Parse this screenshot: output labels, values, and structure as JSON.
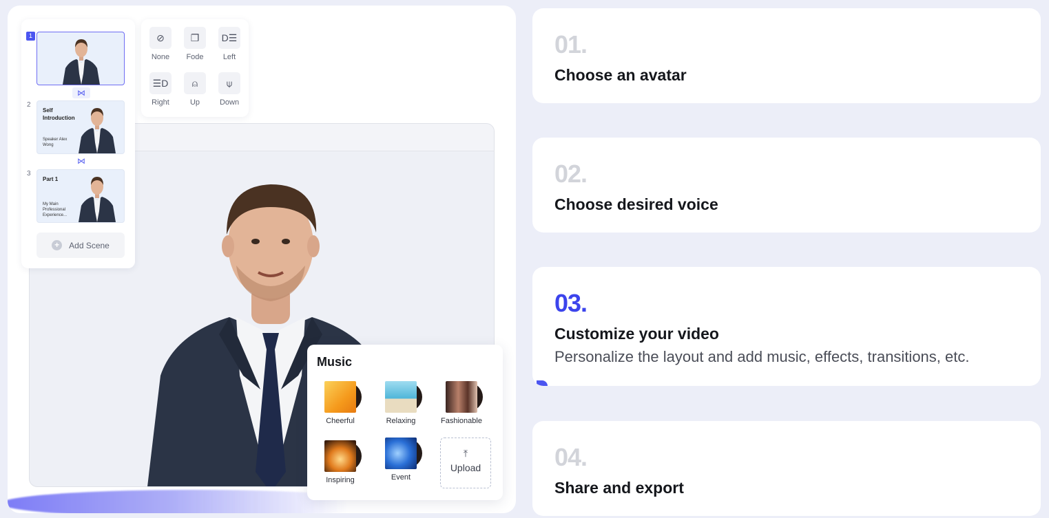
{
  "editor": {
    "scenes": [
      {
        "number": "1",
        "title": "",
        "subtitle": ""
      },
      {
        "number": "2",
        "title": "Self Introduction",
        "subtitle": "Speaker Alex Wong"
      },
      {
        "number": "3",
        "title": "Part 1",
        "subtitle": "My Main Professional Experience..."
      }
    ],
    "add_scene_label": "Add Scene",
    "transitions": [
      {
        "label": "None",
        "icon": "none-icon"
      },
      {
        "label": "Fode",
        "icon": "fade-icon"
      },
      {
        "label": "Left",
        "icon": "left-icon"
      },
      {
        "label": "Right",
        "icon": "right-icon"
      },
      {
        "label": "Up",
        "icon": "up-icon"
      },
      {
        "label": "Down",
        "icon": "down-icon"
      }
    ],
    "music": {
      "title": "Music",
      "tracks": [
        {
          "label": "Cheerful",
          "color": "#f5a41c"
        },
        {
          "label": "Relaxing",
          "color": "#4fb6d9"
        },
        {
          "label": "Fashionable",
          "color": "#7a4c3a"
        },
        {
          "label": "Inspiring",
          "color": "#e07a1c"
        },
        {
          "label": "Event",
          "color": "#2a6fd6"
        }
      ],
      "upload_label": "Upload"
    }
  },
  "steps": [
    {
      "number": "01.",
      "title": "Choose an avatar",
      "description": ""
    },
    {
      "number": "02.",
      "title": "Choose desired voice",
      "description": ""
    },
    {
      "number": "03.",
      "title": "Customize your video",
      "description": "Personalize the layout and add music, effects, transitions, etc."
    },
    {
      "number": "04.",
      "title": "Share and export",
      "description": ""
    }
  ],
  "colors": {
    "accent": "#3c44ec",
    "inactive_number": "#d2d4da",
    "background": "#eceef8"
  }
}
